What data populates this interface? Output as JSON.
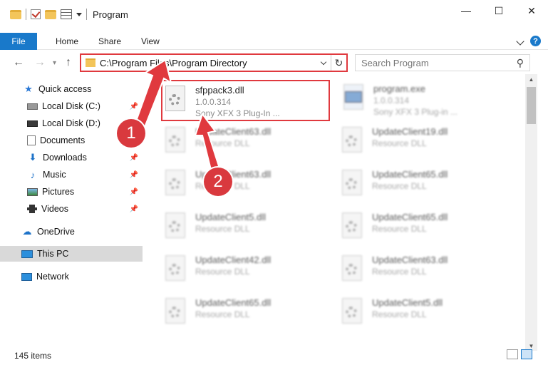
{
  "window": {
    "title": "Program",
    "controls": [
      "—",
      "☐",
      "✕"
    ]
  },
  "ribbon": {
    "file_tab": "File",
    "tabs": [
      "Home",
      "Share",
      "View"
    ],
    "help": "?"
  },
  "address": {
    "path": "C:\\Program Files\\Program Directory",
    "refresh": "↻"
  },
  "search": {
    "placeholder": "Search Program",
    "icon": "search-icon"
  },
  "nav": {
    "back": "←",
    "forward": "→",
    "up": "↑"
  },
  "sidebar": {
    "items": [
      {
        "label": "Quick access",
        "icon": "star-icon"
      },
      {
        "label": "Local Disk (C:)",
        "icon": "drive-icon",
        "pinned": true
      },
      {
        "label": "Local Disk (D:)",
        "icon": "drive-icon"
      },
      {
        "label": "Documents",
        "icon": "documents-icon",
        "pinned": true
      },
      {
        "label": "Downloads",
        "icon": "download-icon",
        "pinned": true
      },
      {
        "label": "Music",
        "icon": "music-icon",
        "pinned": true
      },
      {
        "label": "Pictures",
        "icon": "pictures-icon",
        "pinned": true
      },
      {
        "label": "Videos",
        "icon": "videos-icon",
        "pinned": true
      },
      {
        "label": "OneDrive",
        "icon": "cloud-icon"
      },
      {
        "label": "This PC",
        "icon": "computer-icon",
        "selected": true
      },
      {
        "label": "Network",
        "icon": "network-icon"
      }
    ]
  },
  "files": {
    "highlighted": {
      "name": "sfppack3.dll",
      "version": "1.0.0.314",
      "description": "Sony XFX 3 Plug-In ..."
    },
    "program": {
      "name": "program.exe",
      "version": "1.0.0.314",
      "description": "Sony XFX 3 Plug-in ..."
    },
    "left": [
      {
        "name": "UpdateClient63.dll",
        "desc": "Resource DLL"
      },
      {
        "name": "UpdateClient63.dll",
        "desc": "Resource DLL"
      },
      {
        "name": "UpdateClient5.dll",
        "desc": "Resource DLL"
      },
      {
        "name": "UpdateClient42.dll",
        "desc": "Resource DLL"
      },
      {
        "name": "UpdateClient65.dll",
        "desc": "Resource DLL"
      }
    ],
    "right": [
      {
        "name": "UpdateClient19.dll",
        "desc": "Resource DLL"
      },
      {
        "name": "UpdateClient65.dll",
        "desc": "Resource DLL"
      },
      {
        "name": "UpdateClient65.dll",
        "desc": "Resource DLL"
      },
      {
        "name": "UpdateClient63.dll",
        "desc": "Resource DLL"
      },
      {
        "name": "UpdateClient5.dll",
        "desc": "Resource DLL"
      }
    ]
  },
  "status": {
    "count": "145 items"
  },
  "callouts": {
    "one": "1",
    "two": "2"
  },
  "colors": {
    "accent": "#1979ca",
    "highlight": "#e0393e",
    "callout": "#d9393e"
  }
}
